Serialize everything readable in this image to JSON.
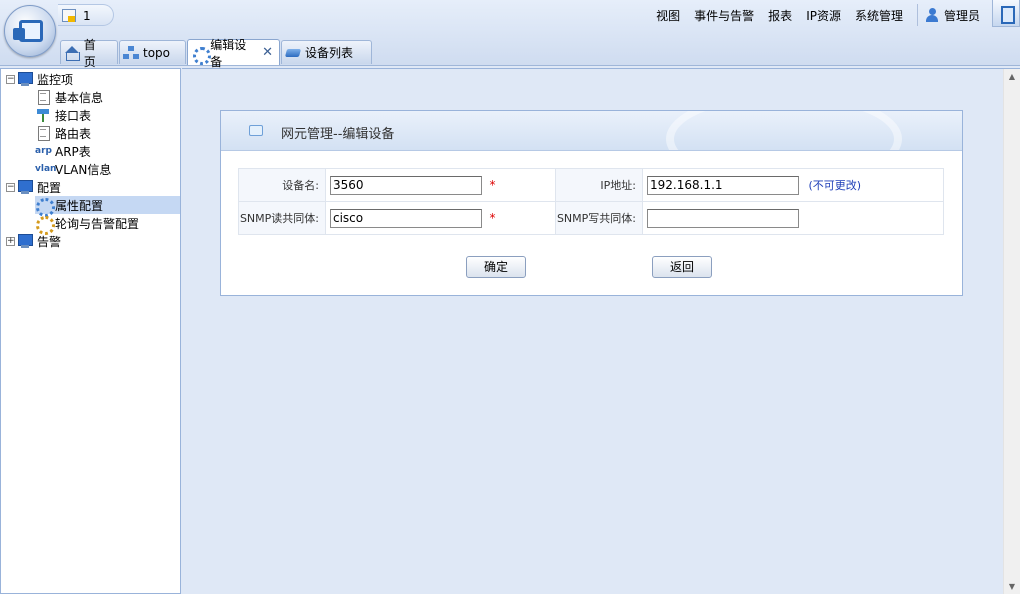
{
  "header": {
    "notification_count": "1",
    "menu": [
      "视图",
      "事件与告警",
      "报表",
      "IP资源",
      "系统管理"
    ],
    "user_name": "管理员"
  },
  "tabs": [
    {
      "label": "首 页",
      "icon": "home-icon"
    },
    {
      "label": "topo",
      "icon": "topo-icon"
    },
    {
      "label": "编辑设备",
      "icon": "gear-icon",
      "active": true,
      "close": "✕"
    },
    {
      "label": "设备列表",
      "icon": "list-icon"
    }
  ],
  "sidebar": {
    "tree": [
      {
        "label": "监控项",
        "toggle": "−",
        "icon": "monitor-icon"
      },
      {
        "label": "基本信息",
        "icon": "doc-icon"
      },
      {
        "label": "接口表",
        "icon": "network-icon"
      },
      {
        "label": "路由表",
        "icon": "doc-icon"
      },
      {
        "label": "ARP表",
        "icon": "arp-icon",
        "icon_text": "arp"
      },
      {
        "label": "VLAN信息",
        "icon": "vlan-icon",
        "icon_text": "vlan"
      },
      {
        "label": "配置",
        "toggle": "−",
        "icon": "monitor-icon"
      },
      {
        "label": "属性配置",
        "icon": "config-icon",
        "selected": true
      },
      {
        "label": "轮询与告警配置",
        "icon": "poll-icon"
      },
      {
        "label": "告警",
        "toggle": "+",
        "icon": "monitor-icon"
      }
    ]
  },
  "panel": {
    "title": "网元管理--编辑设备"
  },
  "form": {
    "device_name_label": "设备名:",
    "device_name_value": "3560",
    "ip_label": "IP地址:",
    "ip_value": "192.168.1.1",
    "ip_note": "(不可更改)",
    "snmp_read_label": "SNMP读共同体:",
    "snmp_read_value": "cisco",
    "snmp_write_label": "SNMP写共同体:",
    "snmp_write_value": "",
    "required_mark": "*",
    "confirm_label": "确定",
    "back_label": "返回"
  }
}
